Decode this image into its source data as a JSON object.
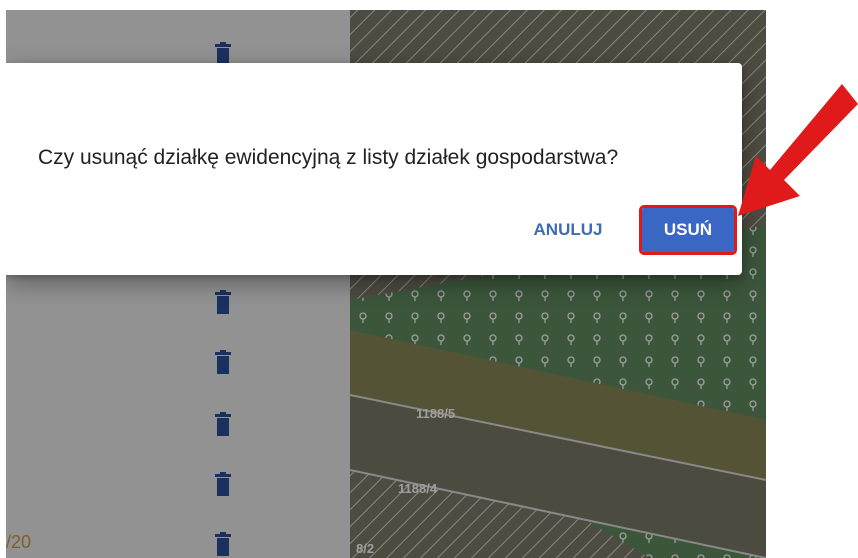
{
  "dialog": {
    "message": "Czy usunąć działkę ewidencyjną z listy działek gospodarstwa?",
    "cancel_label": "ANULUJ",
    "delete_label": "USUŃ"
  },
  "background": {
    "page_indicator": "/20",
    "parcel_labels": [
      "1188/5",
      "1188/4",
      "8/2"
    ]
  },
  "colors": {
    "primary": "#3a66c4",
    "annotation": "#e01a1a",
    "map_green": "#5f8b5f"
  },
  "icons": {
    "row_action": "trash-icon"
  }
}
